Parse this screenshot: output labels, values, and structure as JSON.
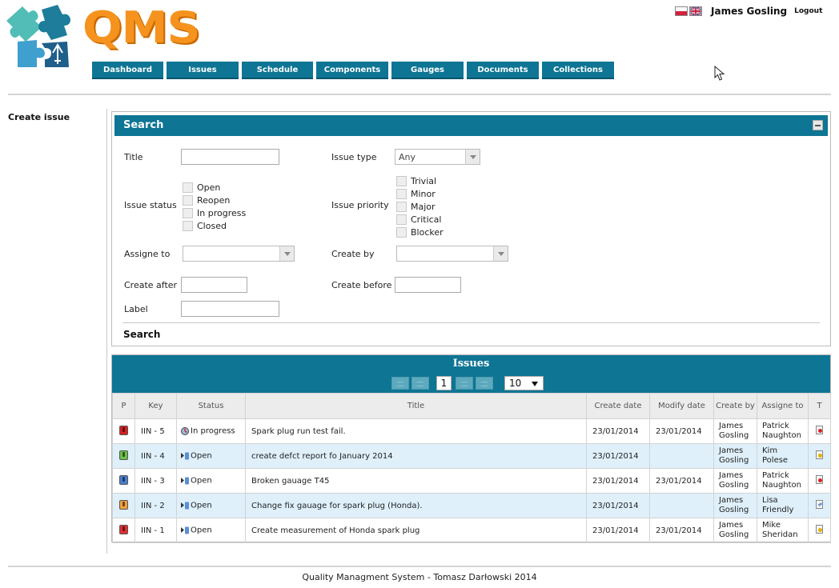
{
  "app": {
    "logo_text": "QMS",
    "footer": "Quality Managment System - Tomasz Darłowski 2014"
  },
  "header": {
    "user_name": "James Gosling",
    "logout_label": "Logout",
    "flags": [
      "polish-flag-icon",
      "uk-flag-icon"
    ]
  },
  "nav": {
    "items": [
      {
        "label": "Dashboard"
      },
      {
        "label": "Issues"
      },
      {
        "label": "Schedule"
      },
      {
        "label": "Components"
      },
      {
        "label": "Gauges"
      },
      {
        "label": "Documents"
      },
      {
        "label": "Collections"
      }
    ]
  },
  "sidebar": {
    "create_issue": "Create issue"
  },
  "search": {
    "heading": "Search",
    "title_label": "Title",
    "title_value": "",
    "issue_type_label": "Issue type",
    "issue_type_value": "Any",
    "issue_status_label": "Issue status",
    "statuses": [
      "Open",
      "Reopen",
      "In progress",
      "Closed"
    ],
    "issue_priority_label": "Issue priority",
    "priorities": [
      "Trivial",
      "Minor",
      "Major",
      "Critical",
      "Blocker"
    ],
    "assign_to_label": "Assigne to",
    "create_by_label": "Create by",
    "create_after_label": "Create after",
    "create_before_label": "Create before",
    "label_label": "Label",
    "search_button": "Search"
  },
  "issues": {
    "heading": "Issues",
    "current_page": "1",
    "rows_per_page": "10",
    "columns": {
      "p": "P",
      "key": "Key",
      "status": "Status",
      "title": "Title",
      "create_date": "Create date",
      "modify_date": "Modify date",
      "create_by": "Create by",
      "assigne_to": "Assigne to",
      "t": "T"
    },
    "rows": [
      {
        "priority_color": "#d62020",
        "key": "IIN - 5",
        "status": "In progress",
        "status_icon": "in-progress-icon",
        "title": "Spark plug run test fail.",
        "create_date": "23/01/2014",
        "modify_date": "23/01/2014",
        "create_by_1": "James",
        "create_by_2": "Gosling",
        "assigne_1": "Patrick",
        "assigne_2": "Naughton",
        "type_icon": "bug-icon"
      },
      {
        "priority_color": "#6cc04a",
        "key": "IIN - 4",
        "status": "Open",
        "status_icon": "open-icon",
        "title": "create defct report fo January 2014",
        "create_date": "23/01/2014",
        "modify_date": "",
        "create_by_1": "James",
        "create_by_2": "Gosling",
        "assigne_1": "Kim",
        "assigne_2": "Polese",
        "type_icon": "task-icon"
      },
      {
        "priority_color": "#4a7fd0",
        "key": "IIN - 3",
        "status": "Open",
        "status_icon": "open-icon",
        "title": "Broken gauage T45",
        "create_date": "23/01/2014",
        "modify_date": "23/01/2014",
        "create_by_1": "James",
        "create_by_2": "Gosling",
        "assigne_1": "Patrick",
        "assigne_2": "Naughton",
        "type_icon": "bug-icon"
      },
      {
        "priority_color": "#f0a040",
        "key": "IIN - 2",
        "status": "Open",
        "status_icon": "open-icon",
        "title": "Change fix gauage for spark plug (Honda).",
        "create_date": "23/01/2014",
        "modify_date": "",
        "create_by_1": "James",
        "create_by_2": "Gosling",
        "assigne_1": "Lisa",
        "assigne_2": "Friendly",
        "type_icon": "improvement-icon"
      },
      {
        "priority_color": "#e03030",
        "key": "IIN - 1",
        "status": "Open",
        "status_icon": "open-icon",
        "title": "Create measurement of Honda spark plug",
        "create_date": "23/01/2014",
        "modify_date": "23/01/2014",
        "create_by_1": "James",
        "create_by_2": "Gosling",
        "assigne_1": "Mike",
        "assigne_2": "Sheridan",
        "type_icon": "task-icon"
      }
    ]
  }
}
